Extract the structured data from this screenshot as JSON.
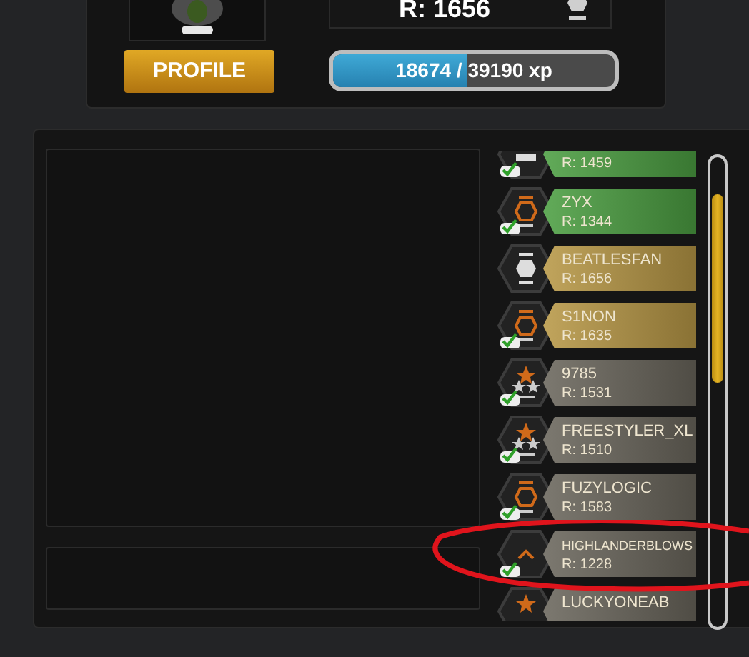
{
  "profile": {
    "rating": "R: 1656",
    "button": "PROFILE",
    "xp": {
      "text": "18674 / 39190 xp",
      "level": 0.476
    }
  },
  "players": [
    {
      "rating": "R: 1459",
      "color": "#4c9f42",
      "kind": "bars",
      "online": true
    },
    {
      "name": "ZYX",
      "rating": "R: 1344",
      "color": "#4c9f42",
      "kind": "hexagon",
      "online": true
    },
    {
      "name": "BEATLESFAN",
      "rating": "R: 1656",
      "color": "#b89846",
      "kind": "silverhexagon",
      "online": false
    },
    {
      "name": "S1NON",
      "rating": "R: 1635",
      "color": "#b89846",
      "kind": "hexagon",
      "online": true
    },
    {
      "name": "9785",
      "rating": "R: 1531",
      "color": "#6a665c",
      "kind": "stars",
      "online": true
    },
    {
      "name": "FREESTYLER_XL",
      "rating": "R: 1510",
      "color": "#6a665c",
      "kind": "stars",
      "online": true
    },
    {
      "name": "FUZYLOGIC",
      "rating": "R: 1583",
      "color": "#6a665c",
      "kind": "hexagon",
      "online": true
    },
    {
      "name": "HIGHLANDERBLOWS",
      "rating": "R: 1228",
      "color": "#6a665c",
      "kind": "chevron",
      "online": true
    },
    {
      "name": "LUCKYONEAB",
      "color": "#6a665c",
      "kind": "star"
    }
  ]
}
